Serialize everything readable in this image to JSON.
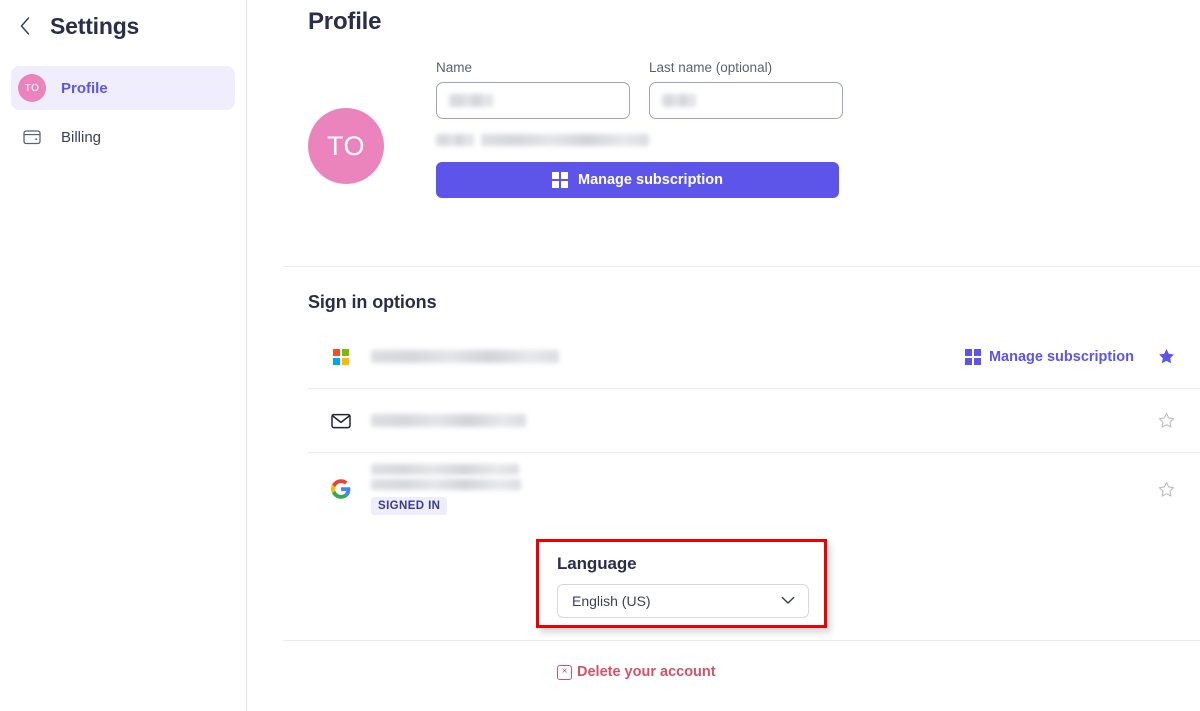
{
  "sidebar": {
    "back_icon": "chevron-left-icon",
    "title": "Settings",
    "items": [
      {
        "label": "Profile",
        "icon": "avatar-initials",
        "initials": "TO",
        "active": true
      },
      {
        "label": "Billing",
        "icon": "wallet-icon",
        "active": false
      }
    ]
  },
  "main": {
    "page_title": "Profile",
    "profile": {
      "avatar_initials": "TO",
      "name_label": "Name",
      "name_value": "",
      "last_name_label": "Last name (optional)",
      "last_name_value": "",
      "email_redacted": true,
      "manage_button_label": "Manage subscription",
      "manage_button_icon": "microsoft-logo-icon"
    },
    "signin": {
      "section_title": "Sign in options",
      "rows": [
        {
          "icon": "microsoft-logo-icon",
          "account_redacted": true,
          "action_label": "Manage subscription",
          "action_icon": "microsoft-logo-icon",
          "starred": true,
          "badge": null
        },
        {
          "icon": "envelope-icon",
          "account_redacted": true,
          "action_label": null,
          "starred": false,
          "badge": null
        },
        {
          "icon": "google-logo-icon",
          "account_redacted": true,
          "action_label": null,
          "starred": false,
          "badge": "SIGNED IN"
        }
      ]
    },
    "language": {
      "title": "Language",
      "selected": "English (US)",
      "chevron_icon": "chevron-down-icon",
      "highlighted": true
    },
    "delete": {
      "label": "Delete your account",
      "icon": "x-box-icon",
      "glyph": "×"
    }
  },
  "colors": {
    "accent_purple": "#5d55ea",
    "avatar_pink": "#eb84bc",
    "active_nav_bg": "#f0eefc",
    "danger_red": "#d4516a",
    "highlight_red": "#ee0000",
    "badge_bg": "#eeedfb",
    "badge_text": "#3b3a8c"
  }
}
